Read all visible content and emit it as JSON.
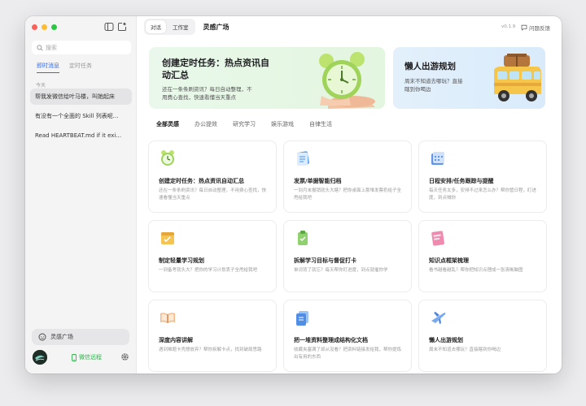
{
  "sidebar": {
    "search_placeholder": "搜索",
    "tabs": [
      "即时消息",
      "定时任务"
    ],
    "section_label": "今天",
    "conversations": [
      "帮我发微信给叶马楼，叫她起床",
      "有没有一个全面的 Skill 列表呢...",
      "Read HEARTBEAT.md if it exi..."
    ],
    "inspire_label": "灵感广场",
    "wechat_label": "微信远程"
  },
  "topbar": {
    "segments": [
      "对话",
      "工作室"
    ],
    "page_title": "灵感广场",
    "version": "v0.1.9",
    "feedback_label": "问题反馈"
  },
  "banners": [
    {
      "title_line1": "创建定时任务：热点资讯自",
      "title_line2": "动汇总",
      "desc_line1": "还在一条条刷资讯？每日自动整理，不",
      "desc_line2": "用费心查找，快速看懂当天重点"
    },
    {
      "title": "懒人出游规划",
      "desc_line1": "周末不知道去哪玩？直接",
      "desc_line2": "瞎到你喝边"
    }
  ],
  "categories": [
    "全部灵感",
    "办公提效",
    "研究学习",
    "娱乐游戏",
    "自律生活"
  ],
  "cards": [
    {
      "icon": "alarm-clock-icon",
      "title": "创建定时任务：热点资讯自动汇总",
      "desc": "还在一条条刷资讯？每日自动整理，不用费心查找，快速看懂当天重点"
    },
    {
      "icon": "invoice-icon",
      "title": "发票/单据智能归档",
      "desc": "一到月末报销就头大瞎？把你桌面上那堆发票扔给子全甩给我吧"
    },
    {
      "icon": "calendar-icon",
      "title": "日程安排/任务跟踪与提醒",
      "desc": "每天任务太多，安排不过来怎么办？帮你管日程，盯进度，到点喊你"
    },
    {
      "icon": "schedule-icon",
      "title": "制定轻量学习规划",
      "desc": "一到备考就头大？把你的学习计划丢子全甩给我吧"
    },
    {
      "icon": "checklist-icon",
      "title": "拆解学习目标与督促打卡",
      "desc": "单词背了就忘？每天帮你盯进度，到点就催你学"
    },
    {
      "icon": "notebook-icon",
      "title": "知识点框架梳理",
      "desc": "看书越看越乱？帮你把知识点理成一张清晰脑图"
    },
    {
      "icon": "open-book-icon",
      "title": "深度内容讲解",
      "desc": "遇到难题卡壳想放弃？帮你拆解卡点，找到破局思路"
    },
    {
      "icon": "documents-icon",
      "title": "把一堆资料整理成结构化文档",
      "desc": "收藏夹塞满了却从没看？把资料链接发给我，帮你提炼出有用的东西"
    },
    {
      "icon": "airplane-icon",
      "title": "懒人出游规划",
      "desc": "周末不知道去哪玩？直接瞎到你喝边"
    }
  ],
  "colors": {
    "accent": "#2f6df6",
    "wechat_green": "#2fb24a"
  }
}
